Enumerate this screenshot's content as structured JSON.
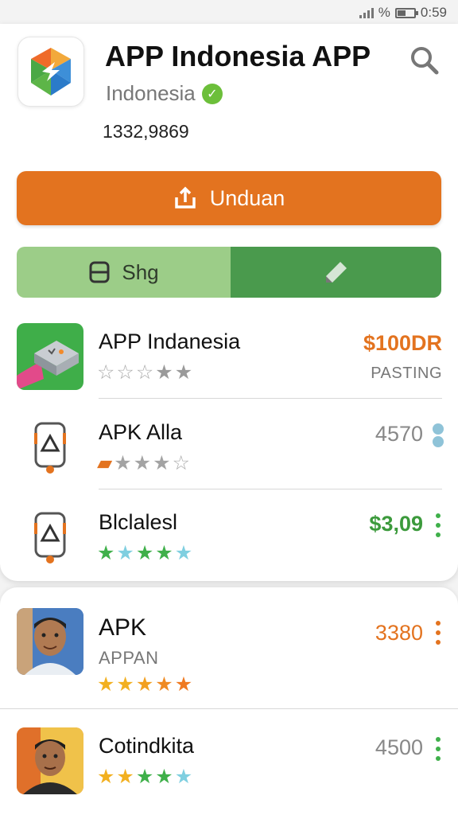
{
  "status_bar": {
    "percent_symbol": "%",
    "time": "0:59"
  },
  "app": {
    "title": "APP Indonesia APP",
    "subtitle": "Indonesia",
    "downloads": "1332,9869",
    "icon": "hexagon-logo-icon"
  },
  "actions": {
    "download_label": "Unduan",
    "share_label": "Shg"
  },
  "list": [
    {
      "title": "APP Indanesia",
      "value": "$100DR",
      "value_color": "#e3731f",
      "sub": "PASTING",
      "rating": 2,
      "max": 5,
      "star_style": "outline-gray"
    },
    {
      "title": "APK Alla",
      "value": "4570",
      "value_color": "#888888",
      "rating": 3,
      "max": 5,
      "star_style": "gray"
    },
    {
      "title": "Blclalesl",
      "value": "$3,09",
      "value_color": "#3c9a3c",
      "rating": 5,
      "max": 5,
      "star_style": "green-blue"
    }
  ],
  "list2": [
    {
      "title": "APK",
      "sub": "APPAN",
      "value": "3380",
      "value_color": "#e3731f",
      "rating": 5,
      "max": 5,
      "star_style": "gold-orange"
    },
    {
      "title": "Cotindkita",
      "value": "4500",
      "value_color": "#888888",
      "rating": 5,
      "max": 5,
      "star_style": "gold-green"
    }
  ],
  "colors": {
    "accent": "#e3731f",
    "share_left": "#9ccd88",
    "share_right": "#4a9a4d"
  }
}
